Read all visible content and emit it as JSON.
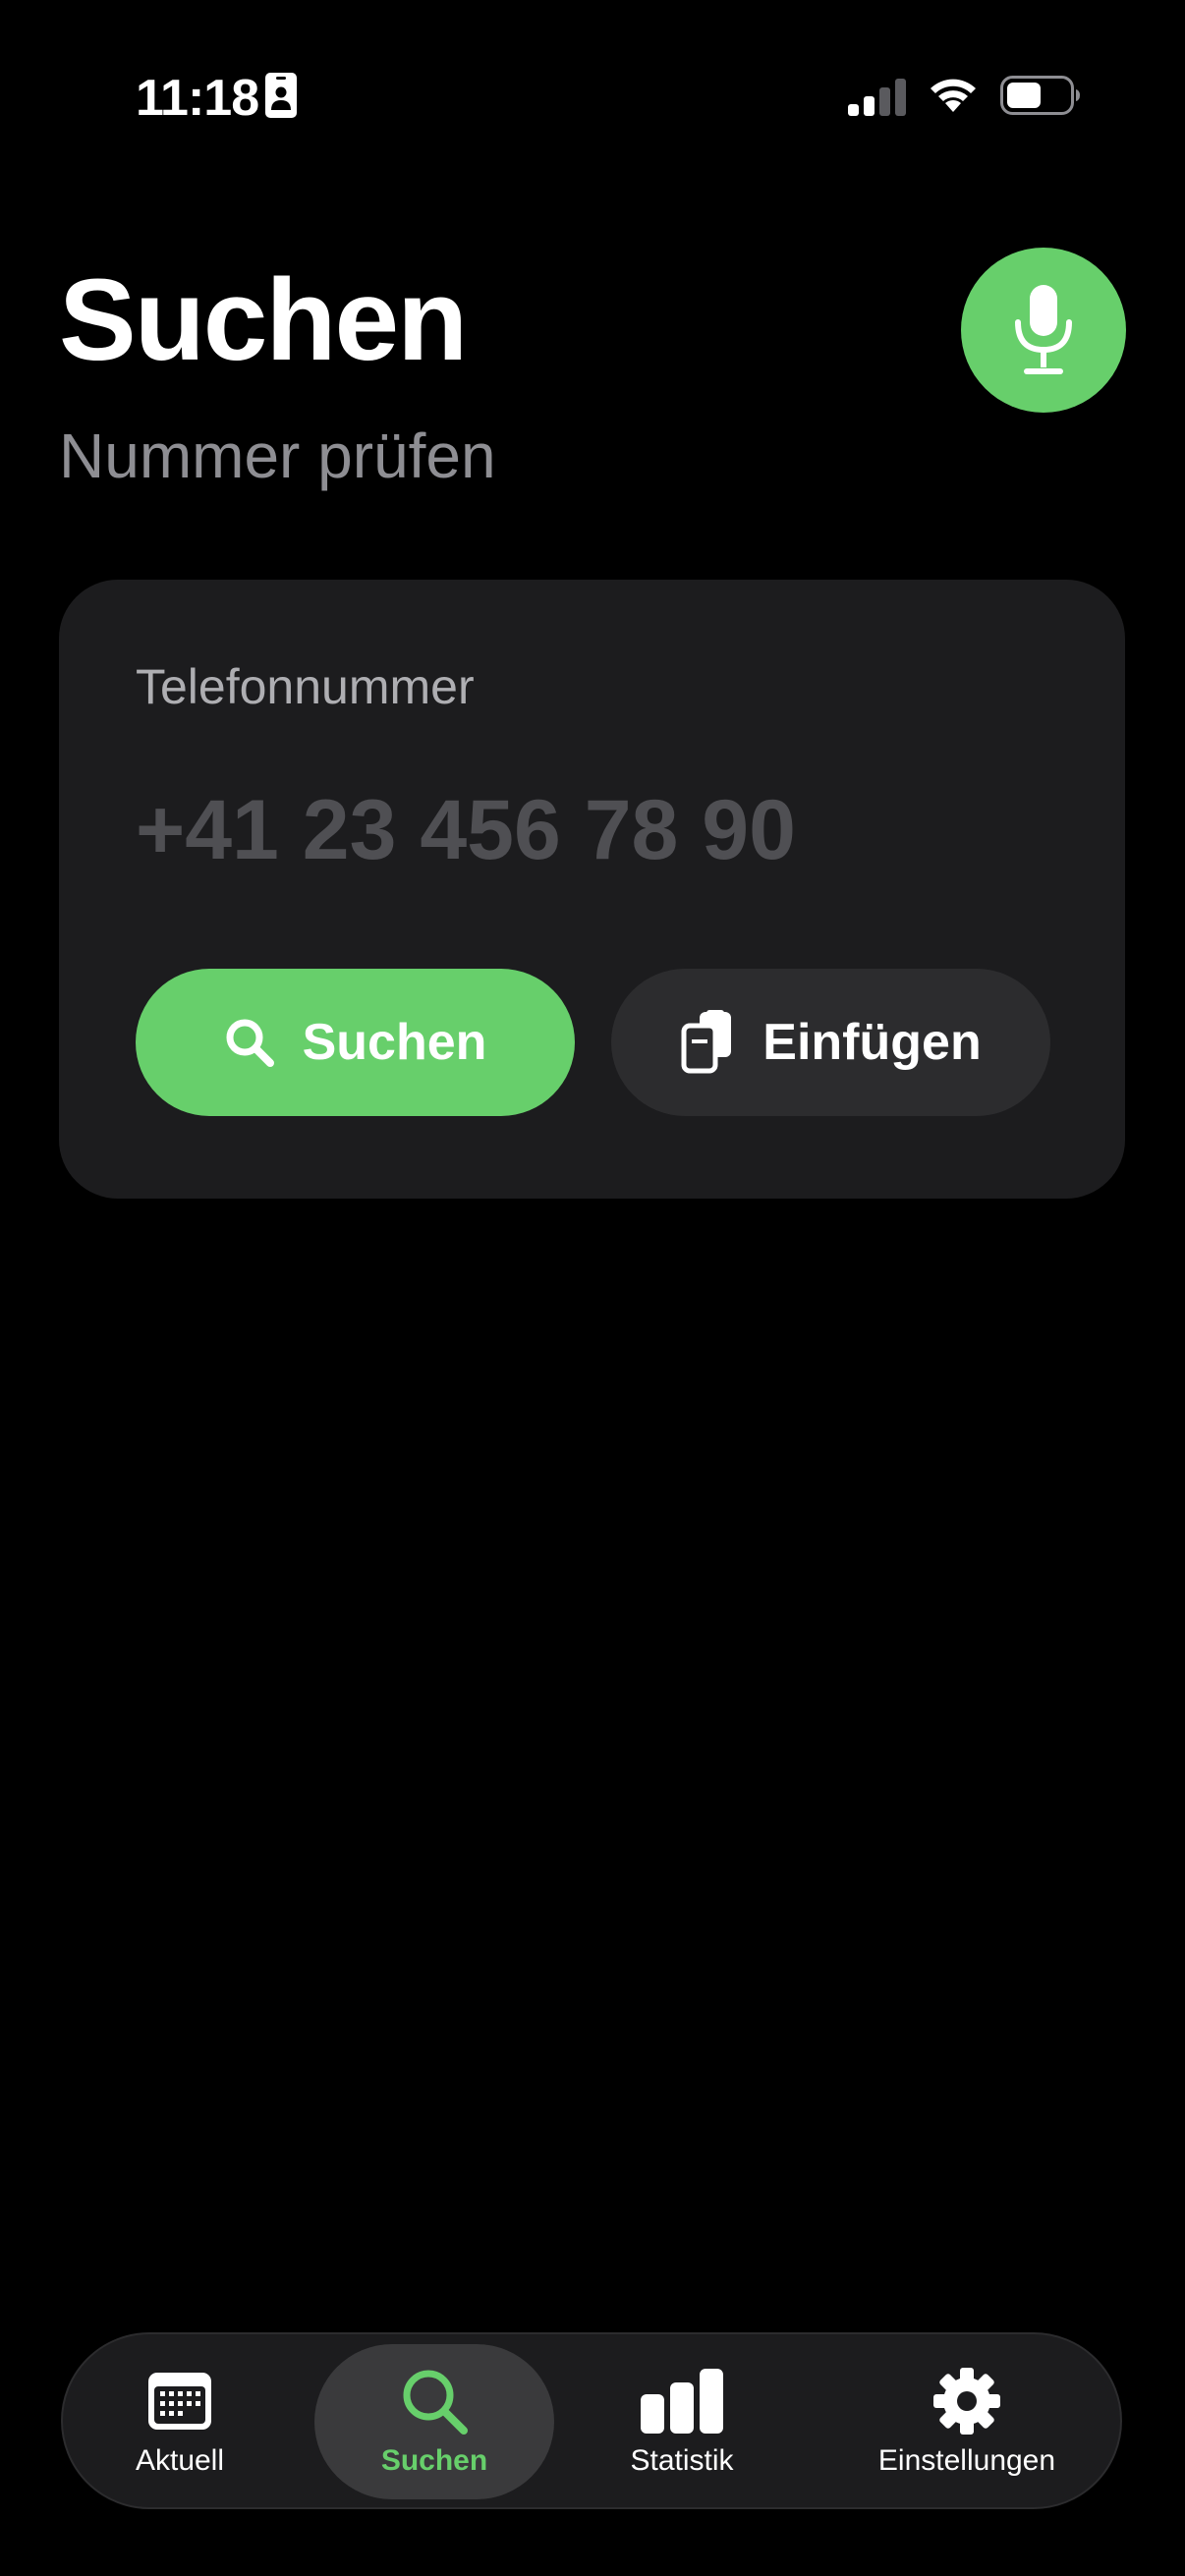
{
  "status_bar": {
    "time": "11:18"
  },
  "header": {
    "title": "Suchen",
    "subtitle": "Nummer prüfen",
    "mic_icon": "microphone-icon"
  },
  "search_card": {
    "label": "Telefonnummer",
    "phone_placeholder": "+41 23 456 78 90",
    "phone_value": "",
    "search_button": "Suchen",
    "paste_button": "Einfügen"
  },
  "tab_bar": {
    "tabs": [
      {
        "label": "Aktuell",
        "icon": "calendar-icon",
        "selected": false
      },
      {
        "label": "Suchen",
        "icon": "search-icon",
        "selected": true
      },
      {
        "label": "Statistik",
        "icon": "bar-chart-icon",
        "selected": false
      },
      {
        "label": "Einstellungen",
        "icon": "gear-icon",
        "selected": false
      }
    ]
  },
  "colors": {
    "accent": "#67cf6b",
    "background": "#000000",
    "card": "#1c1c1e",
    "secondary_text": "#8e8e93"
  }
}
